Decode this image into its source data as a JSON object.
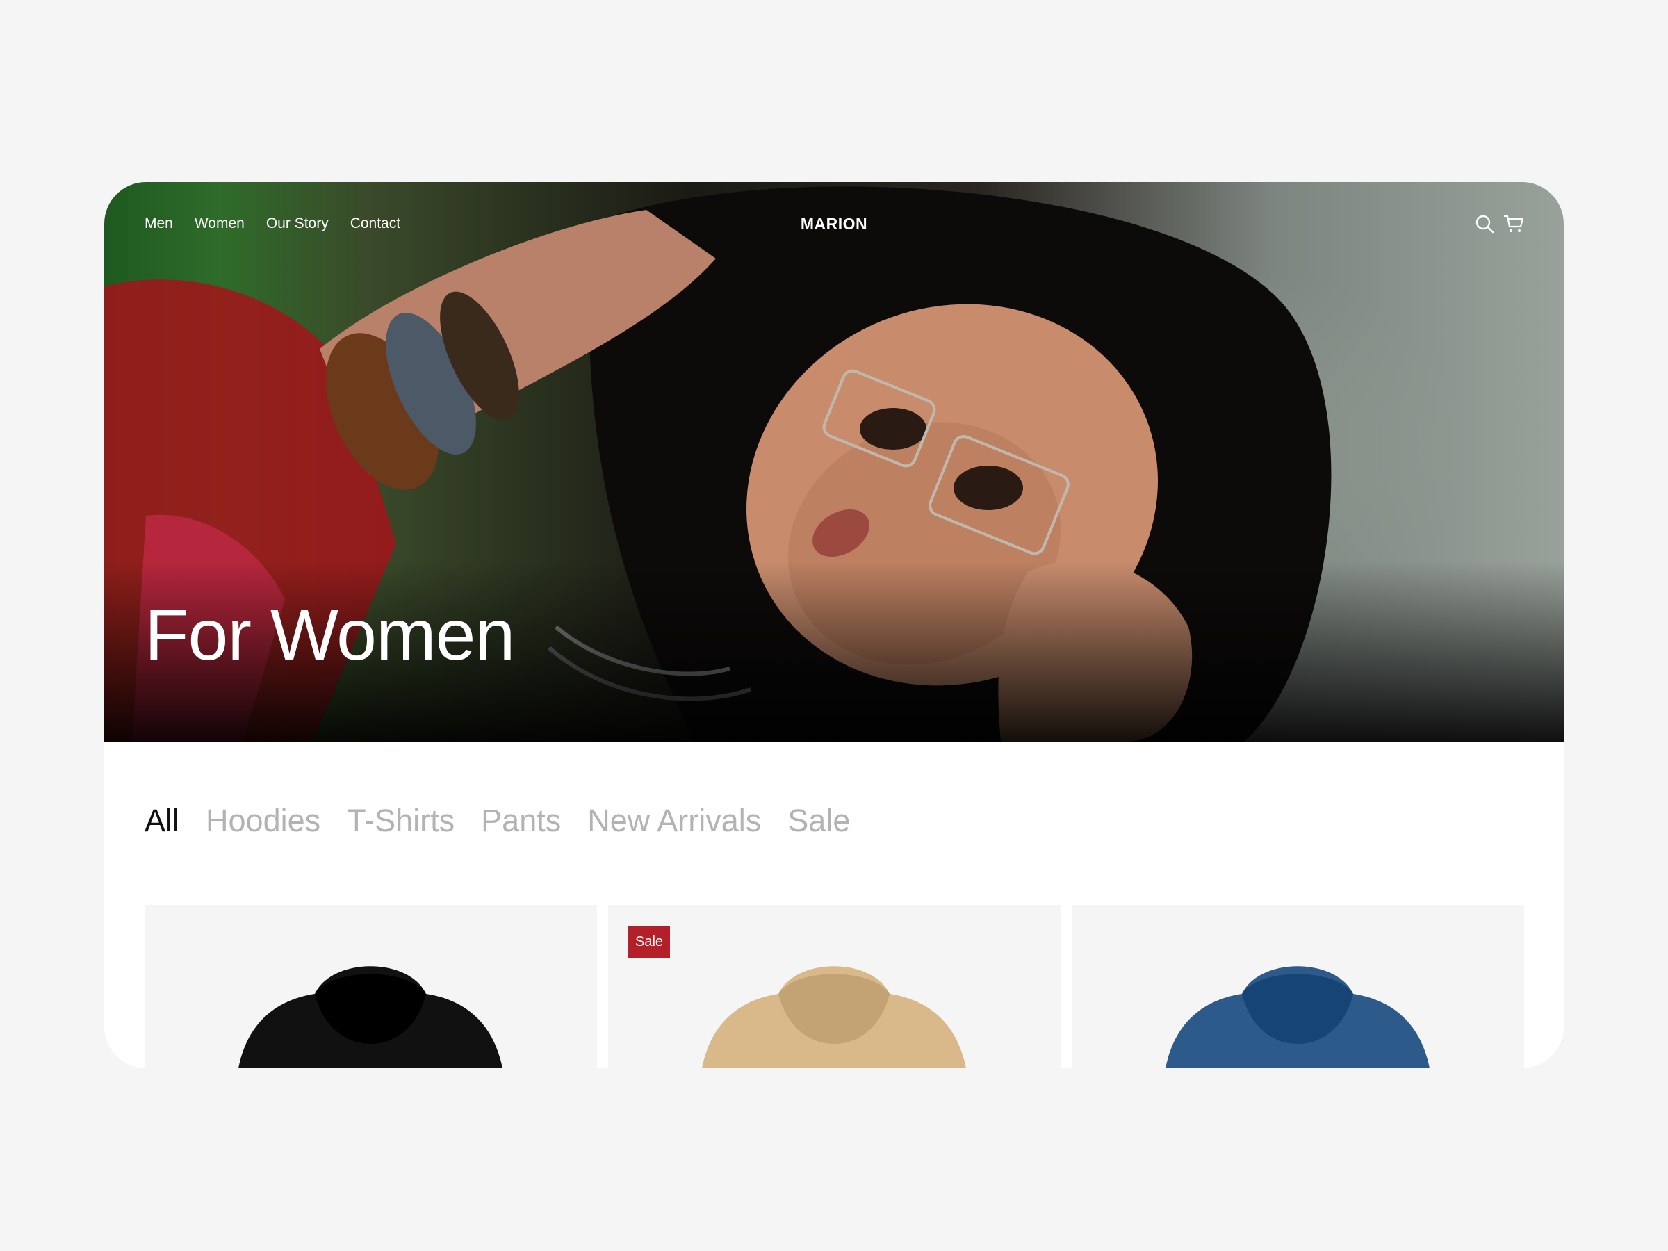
{
  "header": {
    "nav_items": [
      "Men",
      "Women",
      "Our Story",
      "Contact"
    ],
    "brand": "MARION",
    "icons": [
      "search-icon",
      "cart-icon"
    ]
  },
  "hero": {
    "title": "For Women"
  },
  "filters": {
    "tabs": [
      "All",
      "Hoodies",
      "T-Shirts",
      "Pants",
      "New Arrivals",
      "Sale"
    ],
    "active": "All"
  },
  "products": [
    {
      "color": "#111111",
      "badge": ""
    },
    {
      "color": "#d9b88a",
      "badge": "Sale"
    },
    {
      "color": "#2c5a8a",
      "badge": ""
    }
  ],
  "colors": {
    "page_bg": "#f5f5f5",
    "sale_badge": "#b3202a",
    "tab_active": "#111111",
    "tab_inactive": "#b3b3b3"
  }
}
